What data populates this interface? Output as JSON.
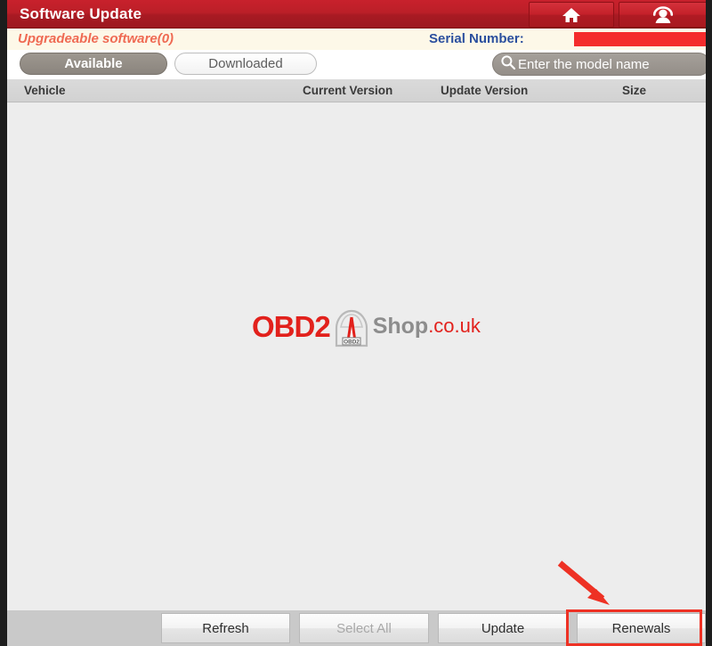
{
  "window": {
    "title": "Software Update"
  },
  "header": {
    "buttons": [
      {
        "name": "home-button",
        "icon": "home-icon"
      },
      {
        "name": "support-button",
        "icon": "user-headset-icon"
      }
    ]
  },
  "info_strip": {
    "upgradeable_label": "Upgradeable software(0)",
    "serial_label": "Serial Number:",
    "serial_value_redacted": true,
    "redaction_color": "#f42c2c"
  },
  "toolbar": {
    "tabs": [
      {
        "label": "Available",
        "active": true
      },
      {
        "label": "Downloaded",
        "active": false
      }
    ],
    "search": {
      "placeholder": "Enter the model name",
      "value": "",
      "icon": "search-icon"
    }
  },
  "table": {
    "columns": [
      {
        "key": "vehicle",
        "label": "Vehicle"
      },
      {
        "key": "current_version",
        "label": "Current Version"
      },
      {
        "key": "update_version",
        "label": "Update Version"
      },
      {
        "key": "size",
        "label": "Size"
      }
    ],
    "rows": [],
    "row_count": 0
  },
  "watermark": {
    "brand_prefix": "OBD2",
    "plate_text": "OBD2",
    "brand_mid": "Shop",
    "brand_suffix": ".co.uk",
    "prefix_color": "#e2211c",
    "mid_color": "#8d8d8d",
    "suffix_color": "#e2211c"
  },
  "bottom_bar": {
    "buttons": [
      {
        "label": "Refresh",
        "enabled": true,
        "highlighted": false
      },
      {
        "label": "Select All",
        "enabled": false,
        "highlighted": false
      },
      {
        "label": "Update",
        "enabled": true,
        "highlighted": false
      },
      {
        "label": "Renewals",
        "enabled": true,
        "highlighted": true
      }
    ]
  },
  "annotations": {
    "highlight_color": "#ee3124",
    "target_label": "Renewals"
  },
  "theme": {
    "titlebar_red": "#bb1f28",
    "accent_red": "#e2211c",
    "info_strip_cream": "#fdf8e8",
    "content_grey": "#ededed",
    "bottom_bar_grey": "#c9c9c9",
    "serial_label_blue": "#2b4f9e",
    "upgradeable_orange": "#ef6a53"
  }
}
